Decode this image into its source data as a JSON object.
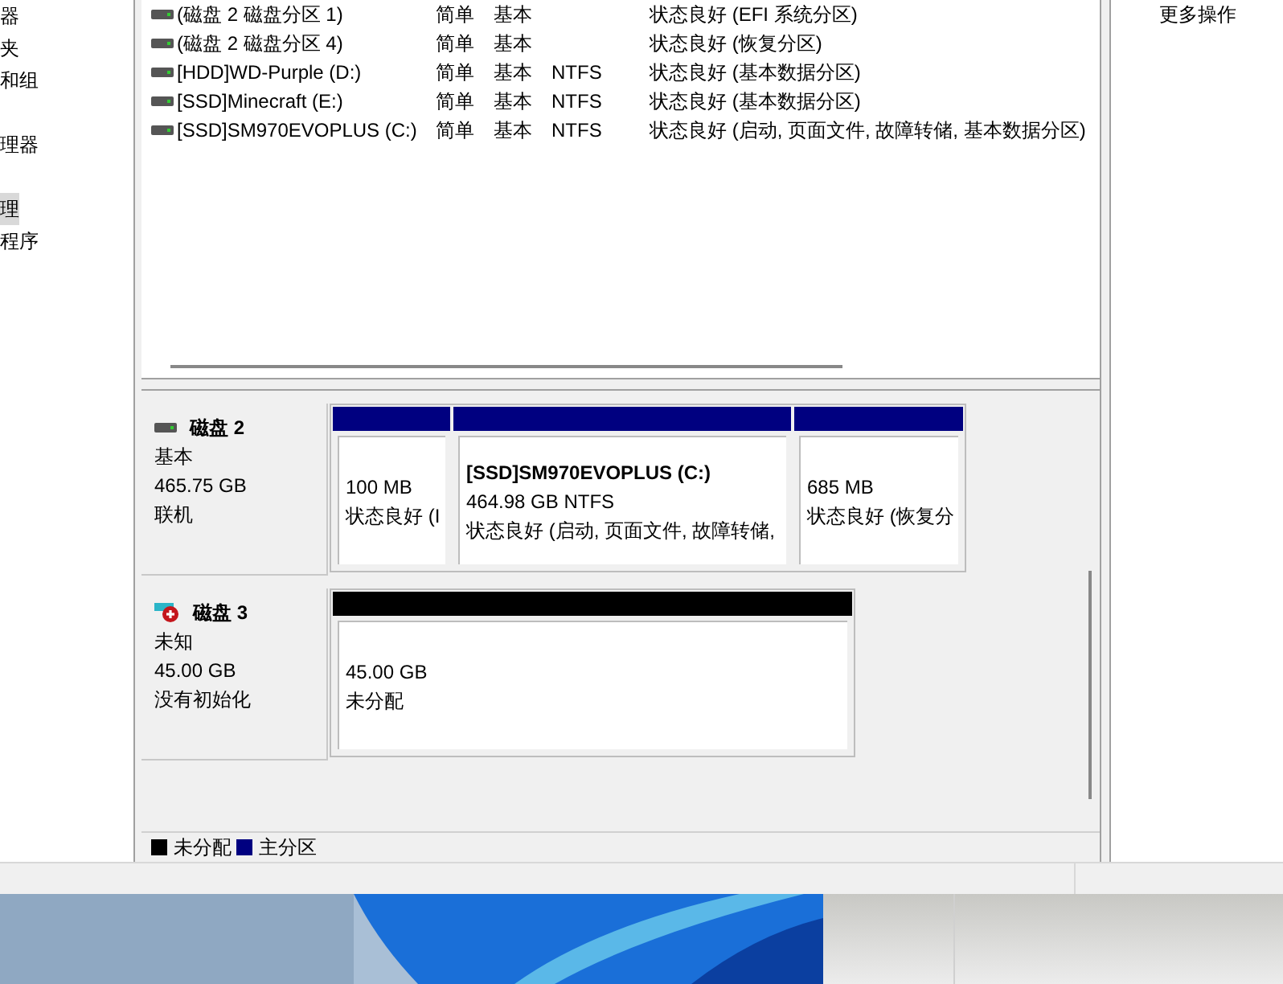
{
  "sidebar": {
    "items": [
      {
        "label": "器",
        "selected": false
      },
      {
        "label": "夹",
        "selected": false
      },
      {
        "label": "和组",
        "selected": false
      },
      {
        "label": "理器",
        "selected": false
      },
      {
        "label": "理",
        "selected": true
      },
      {
        "label": "程序",
        "selected": false
      }
    ]
  },
  "volumes": [
    {
      "name": "(磁盘 2 磁盘分区 1)",
      "layout": "简单",
      "type": "基本",
      "status": "状态良好 (EFI 系统分区)"
    },
    {
      "name": "(磁盘 2 磁盘分区 4)",
      "layout": "简单",
      "type": "基本",
      "status": "状态良好 (恢复分区)"
    },
    {
      "name": "[HDD]WD-Purple (D:)",
      "layout": "简单",
      "type": "基本",
      "fs": "NTFS",
      "status": "状态良好 (基本数据分区)"
    },
    {
      "name": "[SSD]Minecraft (E:)",
      "layout": "简单",
      "type": "基本",
      "fs": "NTFS",
      "status": "状态良好 (基本数据分区)"
    },
    {
      "name": "[SSD]SM970EVOPLUS (C:)",
      "layout": "简单",
      "type": "基本",
      "fs": "NTFS",
      "status": "状态良好 (启动, 页面文件, 故障转储, 基本数据分区)"
    }
  ],
  "disks": [
    {
      "name": "磁盘 2",
      "kind": "online",
      "type": "基本",
      "size": "465.75 GB",
      "state": "联机",
      "partitions": [
        {
          "kind": "primary",
          "size": "100 MB",
          "status": "状态良好 (I"
        },
        {
          "kind": "primary",
          "title": "[SSD]SM970EVOPLUS  (C:)",
          "size": "464.98 GB NTFS",
          "status": "状态良好 (启动, 页面文件, 故障转储,"
        },
        {
          "kind": "primary",
          "size": "685 MB",
          "status": "状态良好 (恢复分"
        }
      ]
    },
    {
      "name": "磁盘 3",
      "kind": "uninitialized",
      "type": "未知",
      "size": "45.00 GB",
      "state": "没有初始化",
      "partitions": [
        {
          "kind": "unallocated",
          "size": "45.00 GB",
          "status": "未分配"
        }
      ]
    }
  ],
  "legend": [
    {
      "kind": "unallocated",
      "label": "未分配"
    },
    {
      "kind": "primary",
      "label": "主分区"
    }
  ],
  "actions": {
    "label": "更多操作"
  }
}
